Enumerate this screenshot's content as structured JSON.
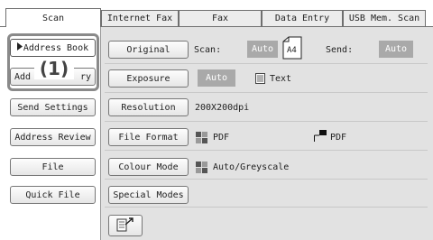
{
  "tabs": [
    {
      "label": "Scan",
      "active": true
    },
    {
      "label": "Internet Fax",
      "active": false
    },
    {
      "label": "Fax",
      "active": false
    },
    {
      "label": "Data Entry",
      "active": false
    },
    {
      "label": "USB Mem. Scan",
      "active": false
    }
  ],
  "sidebar": {
    "items": [
      {
        "label": "Address Book",
        "selected": true
      },
      {
        "label": "Address Entry",
        "selected": false
      },
      {
        "label": "Send Settings",
        "selected": false
      },
      {
        "label": "Address Review",
        "selected": false
      },
      {
        "label": "File",
        "selected": false
      },
      {
        "label": "Quick File",
        "selected": false
      }
    ]
  },
  "callout": {
    "label": "(1)",
    "entry_prefix": "Add",
    "entry_suffix": "ry"
  },
  "settings": {
    "original": {
      "button": "Original",
      "scan_label": "Scan:",
      "scan_value": "Auto",
      "paper": "A4",
      "send_label": "Send:",
      "send_value": "Auto"
    },
    "exposure": {
      "button": "Exposure",
      "value": "Auto",
      "text_value": "Text"
    },
    "resolution": {
      "button": "Resolution",
      "value": "200X200dpi"
    },
    "file_format": {
      "button": "File Format",
      "value1": "PDF",
      "value2": "PDF"
    },
    "colour_mode": {
      "button": "Colour Mode",
      "value": "Auto/Greyscale"
    },
    "special_modes": {
      "button": "Special Modes"
    }
  },
  "icons": {
    "arrow": "triangle-right-icon",
    "paper": "paper-a4-icon",
    "text": "text-doc-icon",
    "pdf": "pdf-grid-icon",
    "file_type": "file-type-icon",
    "colour": "colour-grid-icon",
    "preview": "preview-send-icon"
  },
  "colors": {
    "accent_gray": "#a9a9a9",
    "panel_bg": "#e2e2e2",
    "callout": "#8a8a8a"
  }
}
